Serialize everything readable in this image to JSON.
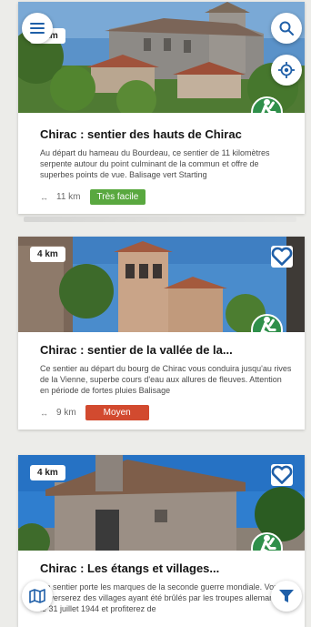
{
  "cards": [
    {
      "km_badge": "5 km",
      "title": "Chirac : sentier des hauts de Chirac",
      "description": "Au départ du hameau du Bourdeau, ce sentier de 11 kilomètres serpente autour du point culminant de la commun et offre de superbes points de vue. Balisage vert Starting",
      "distance": "11 km",
      "difficulty": "Très facile",
      "difficulty_color": "#59a83f"
    },
    {
      "km_badge": "4 km",
      "title": "Chirac : sentier de la vallée de la...",
      "description": "Ce sentier au départ du bourg de Chirac vous conduira jusqu'au rives de la Vienne, superbe cours d'eau aux allures de fleuves. Attention en période de fortes pluies Balisage",
      "distance": "9 km",
      "difficulty": "Moyen",
      "difficulty_color": "#d24a2f"
    },
    {
      "km_badge": "4 km",
      "title": "Chirac : Les étangs et villages...",
      "description": "Ce sentier porte les marques de la seconde guerre mondiale. Vous traverserez des villages ayant été brûlés par les troupes allemandes le 31 juillet 1944 et profiterez de"
    }
  ],
  "icons": {
    "menu": "menu-icon",
    "search": "search-icon",
    "locate": "locate-icon",
    "favorite": "heart-icon",
    "hiker": "hiker-icon",
    "map": "map-icon",
    "filter": "filter-icon",
    "distance": "double-arrow-icon"
  },
  "colors": {
    "accent_blue": "#1f5fa8",
    "hike_green": "#2f8f4a",
    "easy_green": "#59a83f",
    "medium_red": "#d24a2f",
    "background": "#ecece9"
  }
}
